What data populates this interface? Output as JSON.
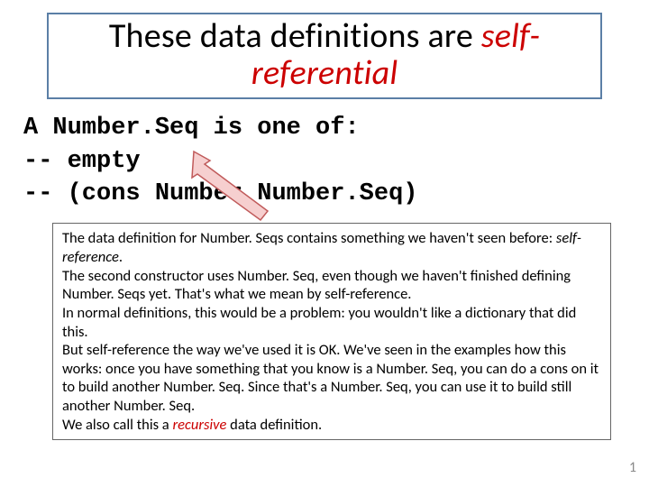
{
  "title": {
    "part1": "These data definitions are ",
    "part2": "self-",
    "part3": "referential"
  },
  "code": "A Number.Seq is one of:\n-- empty\n-- (cons Number Number.Seq)",
  "explain": {
    "p1a": "The data definition for Number. Seqs contains something we haven't seen before: ",
    "p1b": "self-reference",
    "p1c": ".",
    "p2": "The second constructor uses Number. Seq, even though we haven't finished defining Number. Seqs yet.  That's what we mean by self-reference.",
    "p3": "In normal definitions, this would be a problem: you wouldn't like a dictionary that did this.",
    "p4": "But self-reference the way we've used it is OK. We've seen in the examples how this works:  once you have something that you know is a Number. Seq,  you can do a cons on it to build another Number. Seq.  Since that's a Number. Seq, you can use it to build still another Number. Seq.",
    "p5a": "We also call this a ",
    "p5b": "recursive",
    "p5c": " data definition."
  },
  "pageNumber": "1"
}
